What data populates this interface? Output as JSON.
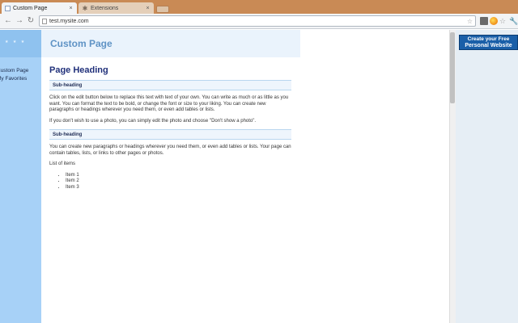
{
  "browser": {
    "tabs": [
      {
        "title": "Custom Page",
        "close": "×"
      },
      {
        "title": "Extensions",
        "close": "×"
      }
    ],
    "address": "test.mysite.com",
    "icons": {
      "back": "back-arrow-icon",
      "forward": "forward-arrow-icon",
      "reload": "reload-icon",
      "star": "bookmark-star-icon",
      "wrench": "wrench-icon"
    }
  },
  "site": {
    "header_title": "Custom Page",
    "nav": [
      "Custom Page",
      "My Favorites"
    ]
  },
  "content": {
    "heading": "Page Heading",
    "subheading1": "Sub-heading",
    "para1": "Click on the edit button below to replace this text with text of your own. You can write as much or as little as you want. You can format the text to be bold, or change the font or size to your liking. You can create new paragraphs or headings wherever you need them, or even add tables or lists.",
    "para2": "If you don't wish to use a photo, you can simply edit the photo and choose \"Don't show a photo\".",
    "subheading2": "Sub-heading",
    "para3": "You can create new paragraphs or headings wherever you need them, or even add tables or lists. Your page can contain tables, lists, or links to other pages or photos.",
    "list_label": "List of items",
    "items": [
      "Item 1",
      "Item 2",
      "Item 3"
    ]
  },
  "ad": {
    "line1": "Create your Free",
    "line2": "Personal Website"
  },
  "colors": {
    "tabstrip": "#c98a55",
    "sidebar": "#a7d1f7",
    "heading": "#20307a",
    "site_title": "#5f93c5",
    "ad": "#1a5fa8"
  }
}
